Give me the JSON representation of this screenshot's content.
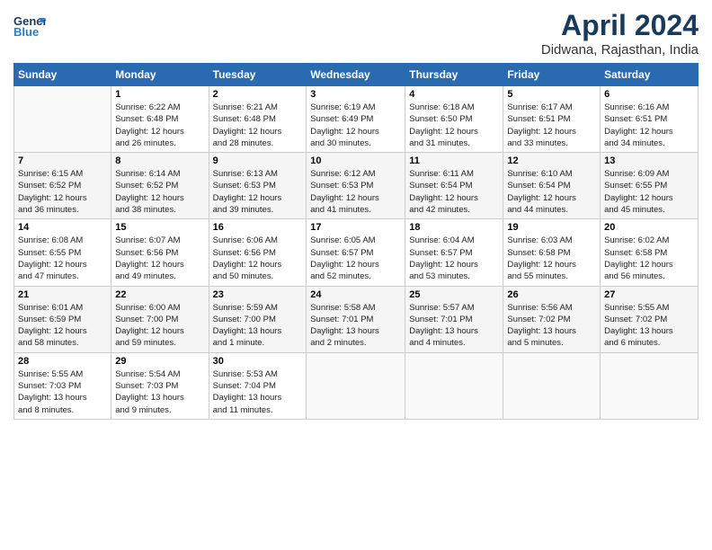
{
  "header": {
    "logo_line1": "General",
    "logo_line2": "Blue",
    "title": "April 2024",
    "subtitle": "Didwana, Rajasthan, India"
  },
  "columns": [
    "Sunday",
    "Monday",
    "Tuesday",
    "Wednesday",
    "Thursday",
    "Friday",
    "Saturday"
  ],
  "weeks": [
    [
      {
        "day": "",
        "info": ""
      },
      {
        "day": "1",
        "info": "Sunrise: 6:22 AM\nSunset: 6:48 PM\nDaylight: 12 hours\nand 26 minutes."
      },
      {
        "day": "2",
        "info": "Sunrise: 6:21 AM\nSunset: 6:48 PM\nDaylight: 12 hours\nand 28 minutes."
      },
      {
        "day": "3",
        "info": "Sunrise: 6:19 AM\nSunset: 6:49 PM\nDaylight: 12 hours\nand 30 minutes."
      },
      {
        "day": "4",
        "info": "Sunrise: 6:18 AM\nSunset: 6:50 PM\nDaylight: 12 hours\nand 31 minutes."
      },
      {
        "day": "5",
        "info": "Sunrise: 6:17 AM\nSunset: 6:51 PM\nDaylight: 12 hours\nand 33 minutes."
      },
      {
        "day": "6",
        "info": "Sunrise: 6:16 AM\nSunset: 6:51 PM\nDaylight: 12 hours\nand 34 minutes."
      }
    ],
    [
      {
        "day": "7",
        "info": "Sunrise: 6:15 AM\nSunset: 6:52 PM\nDaylight: 12 hours\nand 36 minutes."
      },
      {
        "day": "8",
        "info": "Sunrise: 6:14 AM\nSunset: 6:52 PM\nDaylight: 12 hours\nand 38 minutes."
      },
      {
        "day": "9",
        "info": "Sunrise: 6:13 AM\nSunset: 6:53 PM\nDaylight: 12 hours\nand 39 minutes."
      },
      {
        "day": "10",
        "info": "Sunrise: 6:12 AM\nSunset: 6:53 PM\nDaylight: 12 hours\nand 41 minutes."
      },
      {
        "day": "11",
        "info": "Sunrise: 6:11 AM\nSunset: 6:54 PM\nDaylight: 12 hours\nand 42 minutes."
      },
      {
        "day": "12",
        "info": "Sunrise: 6:10 AM\nSunset: 6:54 PM\nDaylight: 12 hours\nand 44 minutes."
      },
      {
        "day": "13",
        "info": "Sunrise: 6:09 AM\nSunset: 6:55 PM\nDaylight: 12 hours\nand 45 minutes."
      }
    ],
    [
      {
        "day": "14",
        "info": "Sunrise: 6:08 AM\nSunset: 6:55 PM\nDaylight: 12 hours\nand 47 minutes."
      },
      {
        "day": "15",
        "info": "Sunrise: 6:07 AM\nSunset: 6:56 PM\nDaylight: 12 hours\nand 49 minutes."
      },
      {
        "day": "16",
        "info": "Sunrise: 6:06 AM\nSunset: 6:56 PM\nDaylight: 12 hours\nand 50 minutes."
      },
      {
        "day": "17",
        "info": "Sunrise: 6:05 AM\nSunset: 6:57 PM\nDaylight: 12 hours\nand 52 minutes."
      },
      {
        "day": "18",
        "info": "Sunrise: 6:04 AM\nSunset: 6:57 PM\nDaylight: 12 hours\nand 53 minutes."
      },
      {
        "day": "19",
        "info": "Sunrise: 6:03 AM\nSunset: 6:58 PM\nDaylight: 12 hours\nand 55 minutes."
      },
      {
        "day": "20",
        "info": "Sunrise: 6:02 AM\nSunset: 6:58 PM\nDaylight: 12 hours\nand 56 minutes."
      }
    ],
    [
      {
        "day": "21",
        "info": "Sunrise: 6:01 AM\nSunset: 6:59 PM\nDaylight: 12 hours\nand 58 minutes."
      },
      {
        "day": "22",
        "info": "Sunrise: 6:00 AM\nSunset: 7:00 PM\nDaylight: 12 hours\nand 59 minutes."
      },
      {
        "day": "23",
        "info": "Sunrise: 5:59 AM\nSunset: 7:00 PM\nDaylight: 13 hours\nand 1 minute."
      },
      {
        "day": "24",
        "info": "Sunrise: 5:58 AM\nSunset: 7:01 PM\nDaylight: 13 hours\nand 2 minutes."
      },
      {
        "day": "25",
        "info": "Sunrise: 5:57 AM\nSunset: 7:01 PM\nDaylight: 13 hours\nand 4 minutes."
      },
      {
        "day": "26",
        "info": "Sunrise: 5:56 AM\nSunset: 7:02 PM\nDaylight: 13 hours\nand 5 minutes."
      },
      {
        "day": "27",
        "info": "Sunrise: 5:55 AM\nSunset: 7:02 PM\nDaylight: 13 hours\nand 6 minutes."
      }
    ],
    [
      {
        "day": "28",
        "info": "Sunrise: 5:55 AM\nSunset: 7:03 PM\nDaylight: 13 hours\nand 8 minutes."
      },
      {
        "day": "29",
        "info": "Sunrise: 5:54 AM\nSunset: 7:03 PM\nDaylight: 13 hours\nand 9 minutes."
      },
      {
        "day": "30",
        "info": "Sunrise: 5:53 AM\nSunset: 7:04 PM\nDaylight: 13 hours\nand 11 minutes."
      },
      {
        "day": "",
        "info": ""
      },
      {
        "day": "",
        "info": ""
      },
      {
        "day": "",
        "info": ""
      },
      {
        "day": "",
        "info": ""
      }
    ]
  ]
}
